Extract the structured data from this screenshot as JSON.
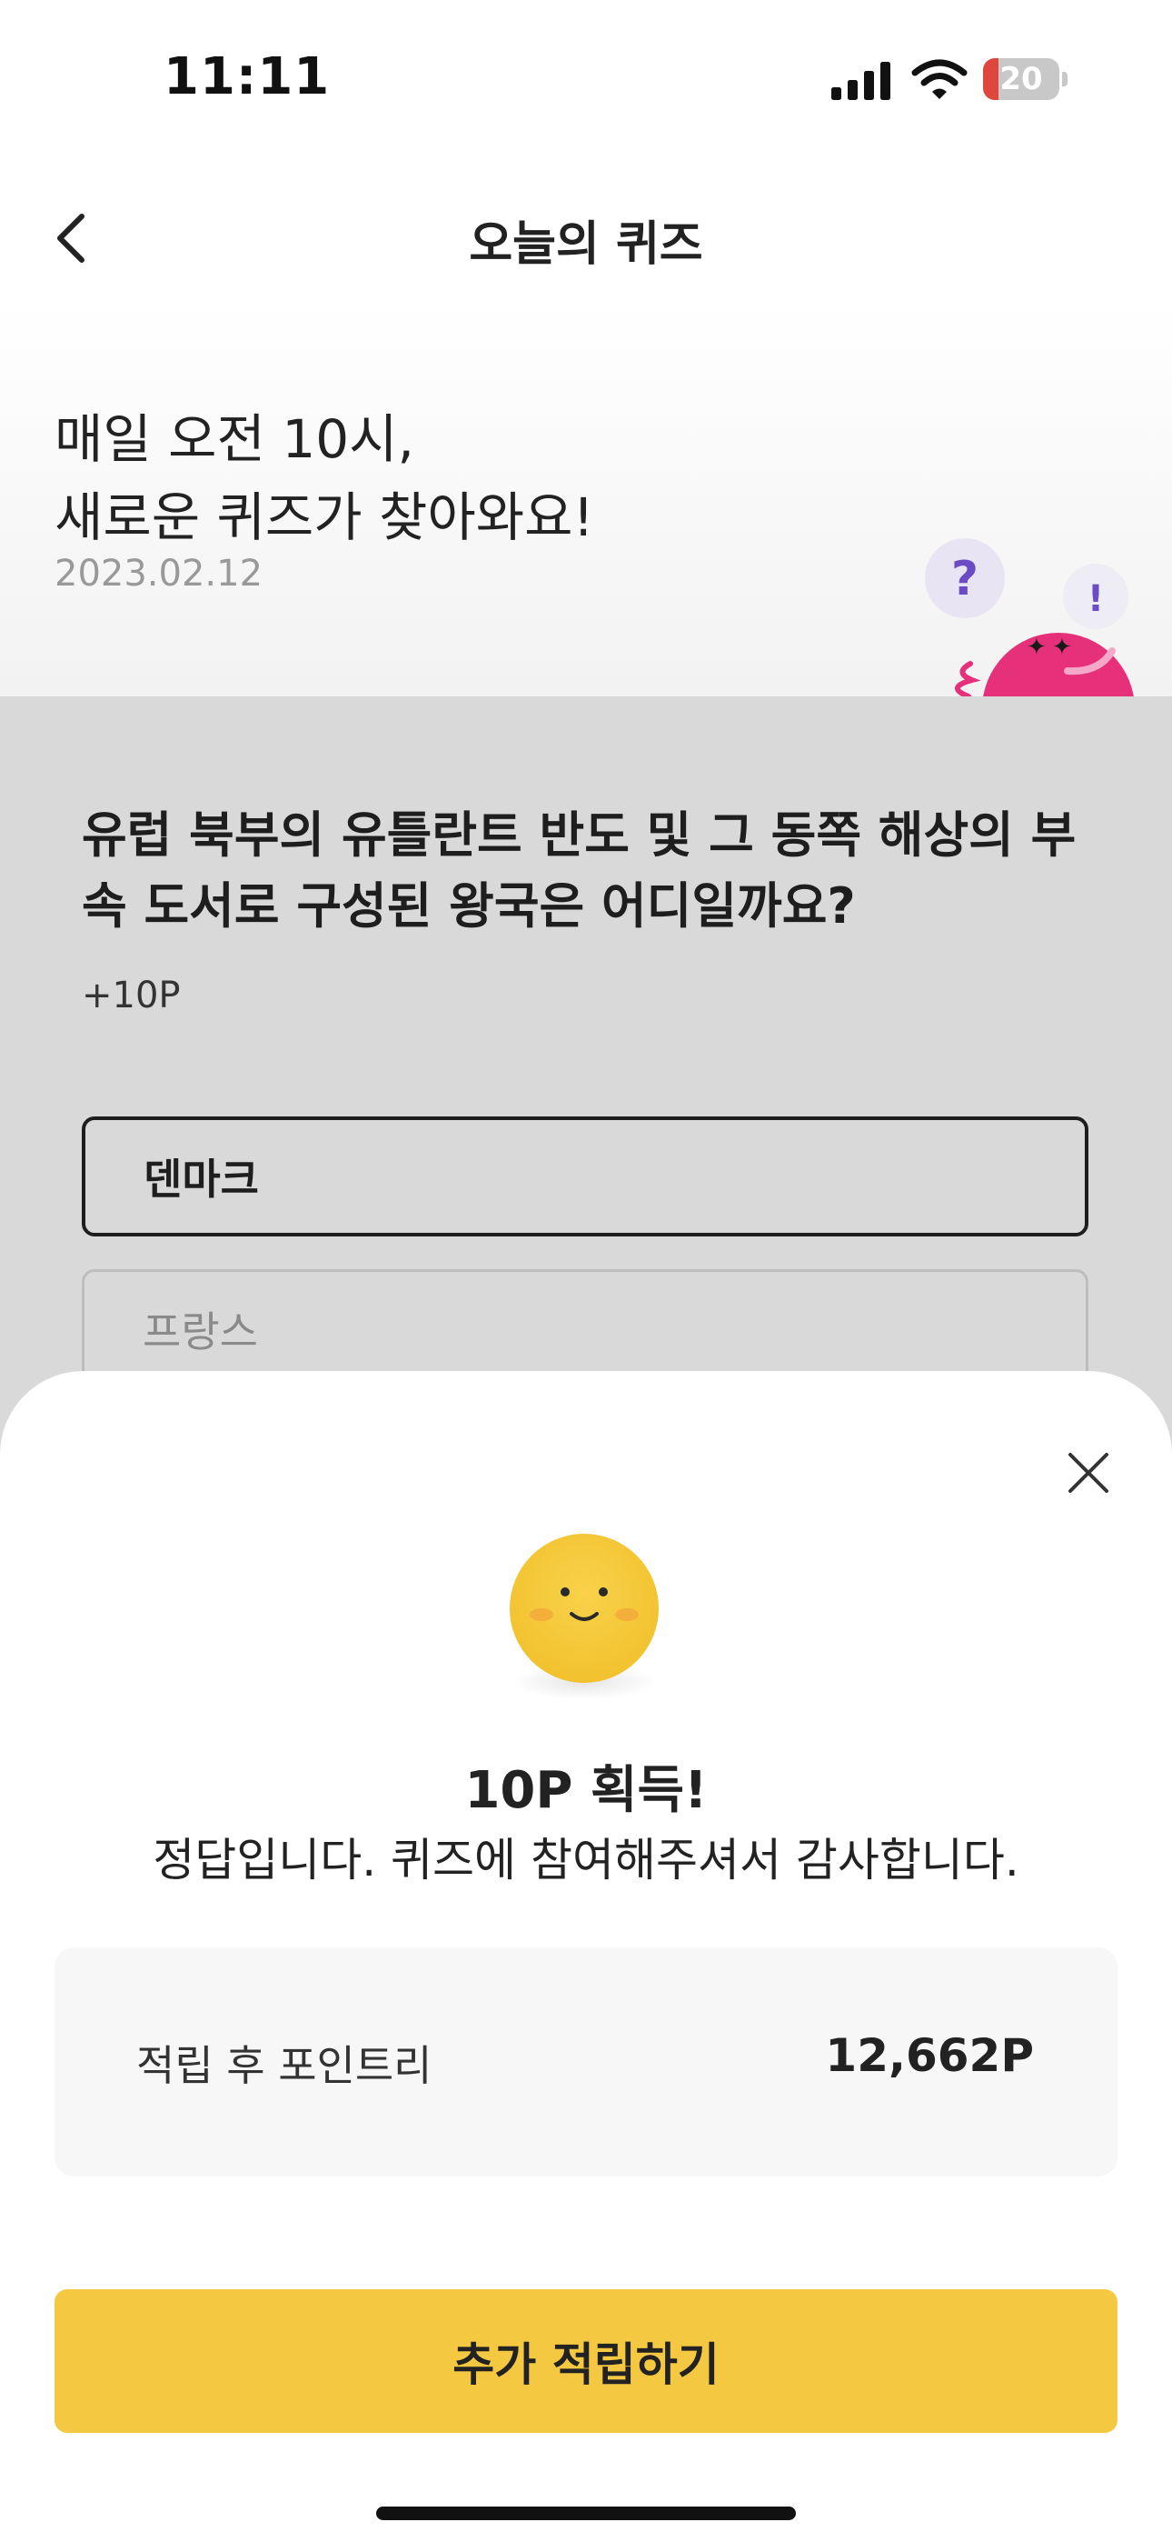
{
  "status_bar": {
    "time": "11:11",
    "battery_level": "20",
    "battery_fraction": 0.2,
    "battery_color": "#e0473c",
    "icons": [
      "signal-icon",
      "wifi-icon",
      "battery-icon"
    ]
  },
  "nav": {
    "back_icon": "chevron-left-icon",
    "title": "오늘의 퀴즈"
  },
  "header": {
    "headline_line1": "매일 오전 10시,",
    "headline_line2": "새로운 퀴즈가 찾아와요!",
    "date": "2023.02.12",
    "mascot_marks": [
      "?",
      "!"
    ]
  },
  "quiz": {
    "question": "유럽 북부의 유틀란트 반도 및 그 동쪽 해상의 부속 도서로 구성된 왕국은 어디일까요?",
    "points": "+10P",
    "options": [
      {
        "label": "덴마크",
        "selected": true
      },
      {
        "label": "프랑스",
        "selected": false
      }
    ]
  },
  "result_sheet": {
    "close_icon": "close-icon",
    "emoji_icon": "smiley-face-icon",
    "title": "10P 획득!",
    "message": "정답입니다. 퀴즈에 참여해주셔서 감사합니다.",
    "points_label": "적립 후 포인트리",
    "points_value": "12,662P",
    "cta_label": "추가 적립하기"
  },
  "colors": {
    "accent": "#f5c842",
    "mascot": "#e6307a",
    "dim_overlay": "#d9d9d9"
  }
}
